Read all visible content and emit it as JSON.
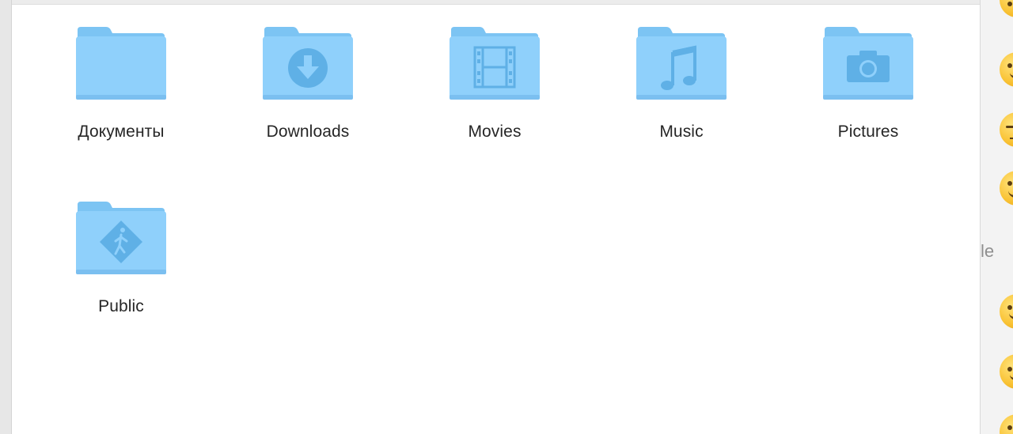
{
  "finder": {
    "folders": [
      {
        "label": "Документы",
        "icon": "folder-icon"
      },
      {
        "label": "Downloads",
        "icon": "downloads-folder-icon"
      },
      {
        "label": "Movies",
        "icon": "movies-folder-icon"
      },
      {
        "label": "Music",
        "icon": "music-folder-icon"
      },
      {
        "label": "Pictures",
        "icon": "pictures-folder-icon"
      },
      {
        "label": "Public",
        "icon": "public-folder-icon"
      }
    ]
  },
  "side_panel": {
    "partial_text": "le",
    "emoji_icons": [
      "emoji-icon",
      "emoji-icon",
      "emoji-icon",
      "emoji-icon",
      "emoji-icon",
      "emoji-icon",
      "emoji-icon"
    ]
  },
  "colors": {
    "folder_back": "#7cc4f3",
    "folder_front": "#8fd0fb",
    "folder_glyph": "#5fb0e6",
    "label_text": "#262626"
  }
}
